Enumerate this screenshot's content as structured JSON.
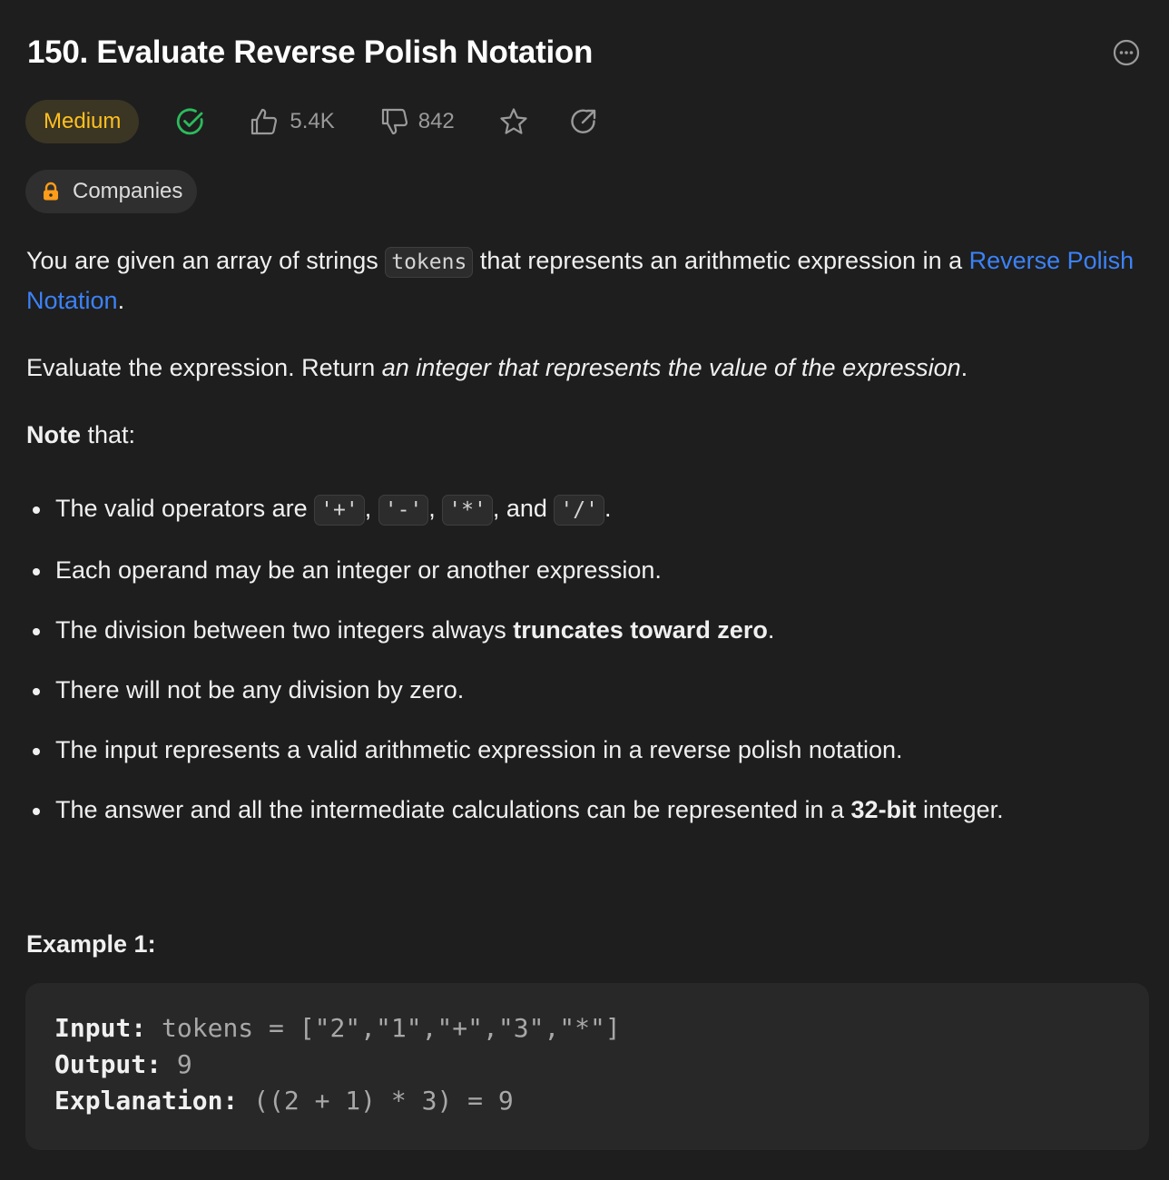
{
  "problem": {
    "title": "150. Evaluate Reverse Polish Notation",
    "difficulty": "Medium",
    "likes": "5.4K",
    "dislikes": "842",
    "companies_label": "Companies"
  },
  "icons": {
    "more": "ellipsis-circle-icon",
    "solved": "check-circle-icon",
    "like": "thumbs-up-icon",
    "dislike": "thumbs-down-icon",
    "favorite": "star-icon",
    "share": "share-icon",
    "lock": "lock-icon"
  },
  "colors": {
    "accent_yellow": "#ffc01e",
    "accent_green": "#2cbb5d",
    "link_blue": "#3c82f6",
    "lock_orange": "#ff9c1a"
  },
  "description": {
    "p1_before": "You are given an array of strings ",
    "p1_code": "tokens",
    "p1_middle": " that represents an arithmetic expression in a ",
    "p1_link": "Reverse Polish Notation",
    "p1_end": ".",
    "p2_before": "Evaluate the expression. Return ",
    "p2_italic": "an integer that represents the value of the expression",
    "p2_end": ".",
    "note_bold": "Note",
    "note_rest": " that:",
    "b1_before": "The valid operators are ",
    "b1_op1": "'+'",
    "b1_sep1": ", ",
    "b1_op2": "'-'",
    "b1_sep2": ", ",
    "b1_op3": "'*'",
    "b1_sep3": ", and ",
    "b1_op4": "'/'",
    "b1_end": ".",
    "b2": "Each operand may be an integer or another expression.",
    "b3_before": "The division between two integers always ",
    "b3_bold": "truncates toward zero",
    "b3_end": ".",
    "b4": "There will not be any division by zero.",
    "b5": "The input represents a valid arithmetic expression in a reverse polish notation.",
    "b6_before": "The answer and all the intermediate calculations can be represented in a ",
    "b6_bold": "32-bit",
    "b6_end": " integer."
  },
  "example1": {
    "heading": "Example 1:",
    "input_label": "Input:",
    "input_value": " tokens = [\"2\",\"1\",\"+\",\"3\",\"*\"]",
    "output_label": "Output:",
    "output_value": " 9",
    "explanation_label": "Explanation:",
    "explanation_value": " ((2 + 1) * 3) = 9"
  }
}
